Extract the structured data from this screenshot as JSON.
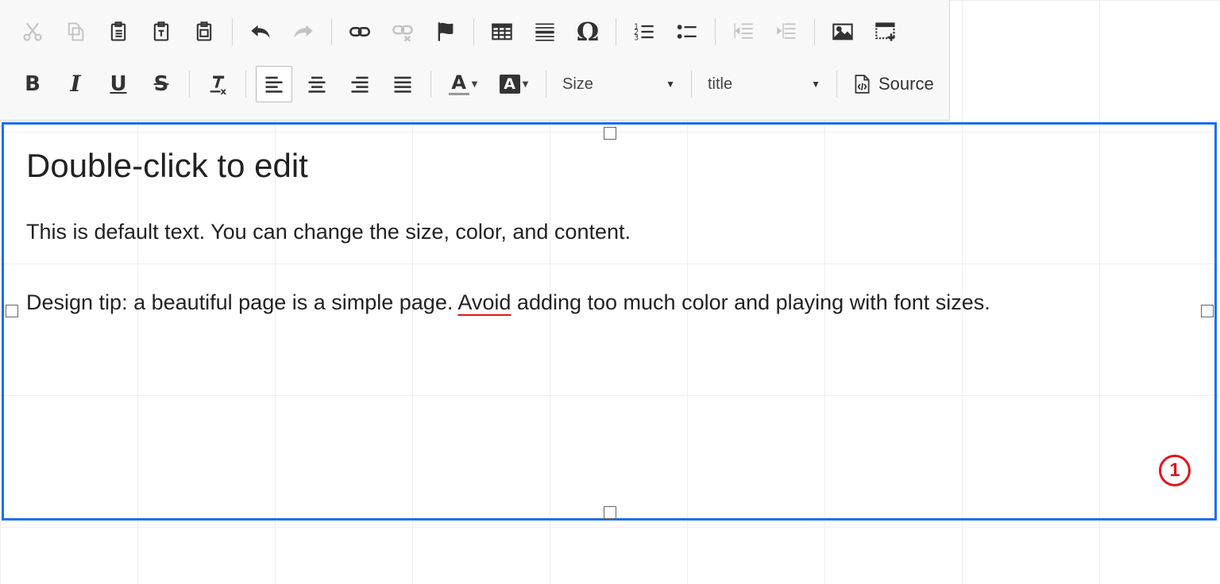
{
  "toolbar": {
    "row1_buttons": [
      {
        "name": "cut",
        "icon": "scissors-icon",
        "disabled": true
      },
      {
        "name": "copy",
        "icon": "copy-icon",
        "disabled": true
      },
      {
        "name": "paste",
        "icon": "clipboard-icon",
        "disabled": false
      },
      {
        "name": "paste-text",
        "icon": "clipboard-text-icon",
        "disabled": false
      },
      {
        "name": "paste-word",
        "icon": "clipboard-word-icon",
        "disabled": false
      },
      {
        "name": "undo",
        "icon": "undo-icon",
        "disabled": false
      },
      {
        "name": "redo",
        "icon": "redo-icon",
        "disabled": true
      },
      {
        "name": "link",
        "icon": "link-icon",
        "disabled": false
      },
      {
        "name": "unlink",
        "icon": "unlink-icon",
        "disabled": true
      },
      {
        "name": "anchor",
        "icon": "flag-icon",
        "disabled": false
      },
      {
        "name": "table",
        "icon": "table-icon",
        "disabled": false
      },
      {
        "name": "horizontal-rule",
        "icon": "horizontal-rule-icon",
        "disabled": false
      },
      {
        "name": "special-char",
        "icon": "omega-icon",
        "disabled": false
      },
      {
        "name": "numbered-list",
        "icon": "numbered-list-icon",
        "disabled": false
      },
      {
        "name": "bulleted-list",
        "icon": "bulleted-list-icon",
        "disabled": false
      },
      {
        "name": "decrease-indent",
        "icon": "outdent-icon",
        "disabled": true
      },
      {
        "name": "increase-indent",
        "icon": "indent-icon",
        "disabled": true
      },
      {
        "name": "image",
        "icon": "image-icon",
        "disabled": false
      },
      {
        "name": "iframe",
        "icon": "iframe-icon",
        "disabled": false
      }
    ],
    "bold_label": "B",
    "italic_label": "I",
    "underline_label": "U",
    "strike_label": "S",
    "text_color_label": "A",
    "bg_color_label": "A",
    "size_label": "Size",
    "format_label": "title",
    "source_label": "Source"
  },
  "editor": {
    "heading": "Double-click to edit",
    "paragraph1": "This is default text. You can change the size, color, and content.",
    "paragraph2_before": "Design tip: a beautiful page is a simple page. ",
    "paragraph2_misspelled": "Avoid",
    "paragraph2_after": " adding too much color and playing with font sizes.",
    "marker_label": "1"
  },
  "colors": {
    "selection_border": "#1b6ff0",
    "spellcheck_underline": "#e0161c",
    "marker": "#e0161c",
    "toolbar_bg": "#f8f8f8"
  }
}
